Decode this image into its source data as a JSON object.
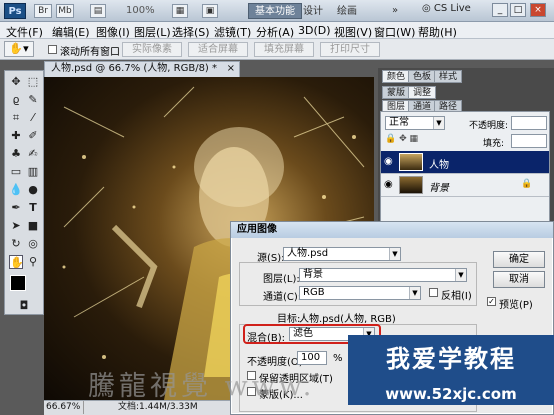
{
  "titlebar": {
    "logo": "Ps",
    "zoom": "100%",
    "workspace_active": "基本功能",
    "workspaces": [
      "设计",
      "绘画"
    ],
    "cs_live": "CS Live"
  },
  "menubar": {
    "items": [
      "文件(F)",
      "编辑(E)",
      "图像(I)",
      "图层(L)",
      "选择(S)",
      "滤镜(T)",
      "分析(A)",
      "3D(D)",
      "视图(V)",
      "窗口(W)",
      "帮助(H)"
    ]
  },
  "options": {
    "scroll_all": "滚动所有窗口",
    "buttons": [
      "实际像素",
      "适合屏幕",
      "填充屏幕",
      "打印尺寸"
    ]
  },
  "document": {
    "tab_title": "人物.psd @ 66.7% (人物, RGB/8) *",
    "zoom": "66.67%",
    "doc_size": "文档:1.44M/3.33M"
  },
  "panels": {
    "tabs_top": [
      "颜色",
      "色板",
      "样式"
    ],
    "tabs_mid": [
      "蒙版",
      "调整"
    ],
    "tabs_layers": [
      "图层",
      "通道",
      "路径"
    ],
    "blend_mode": "正常",
    "opacity_label": "不透明度:",
    "fill_label": "填充:",
    "layers": [
      {
        "name": "人物",
        "selected": true
      },
      {
        "name": "背景",
        "selected": false,
        "italic": true
      }
    ]
  },
  "dialog": {
    "title": "应用图像",
    "source_label": "源(S):",
    "source_value": "人物.psd",
    "layer_label": "图层(L):",
    "layer_value": "背景",
    "channel_label": "通道(C):",
    "channel_value": "RGB",
    "invert_label": "反相(I)",
    "target_label": "目标:",
    "target_value": "人物.psd(人物, RGB)",
    "blend_label": "混合(B):",
    "blend_value": "滤色",
    "opacity_label": "不透明度(O):",
    "opacity_value": "100",
    "opacity_unit": "%",
    "preserve_label": "保留透明区域(T)",
    "mask_label": "蒙版(K)...",
    "ok": "确定",
    "cancel": "取消",
    "preview": "预览(P)"
  },
  "watermark": {
    "site_name": "我爱学教程",
    "url": "www.52xjc.com",
    "gray_text": "騰龍視覺 www."
  },
  "colors": {
    "layer_selected": "#0a246a",
    "blend_highlight": "#d0201a",
    "watermark_bg": "#1f4d8a"
  }
}
